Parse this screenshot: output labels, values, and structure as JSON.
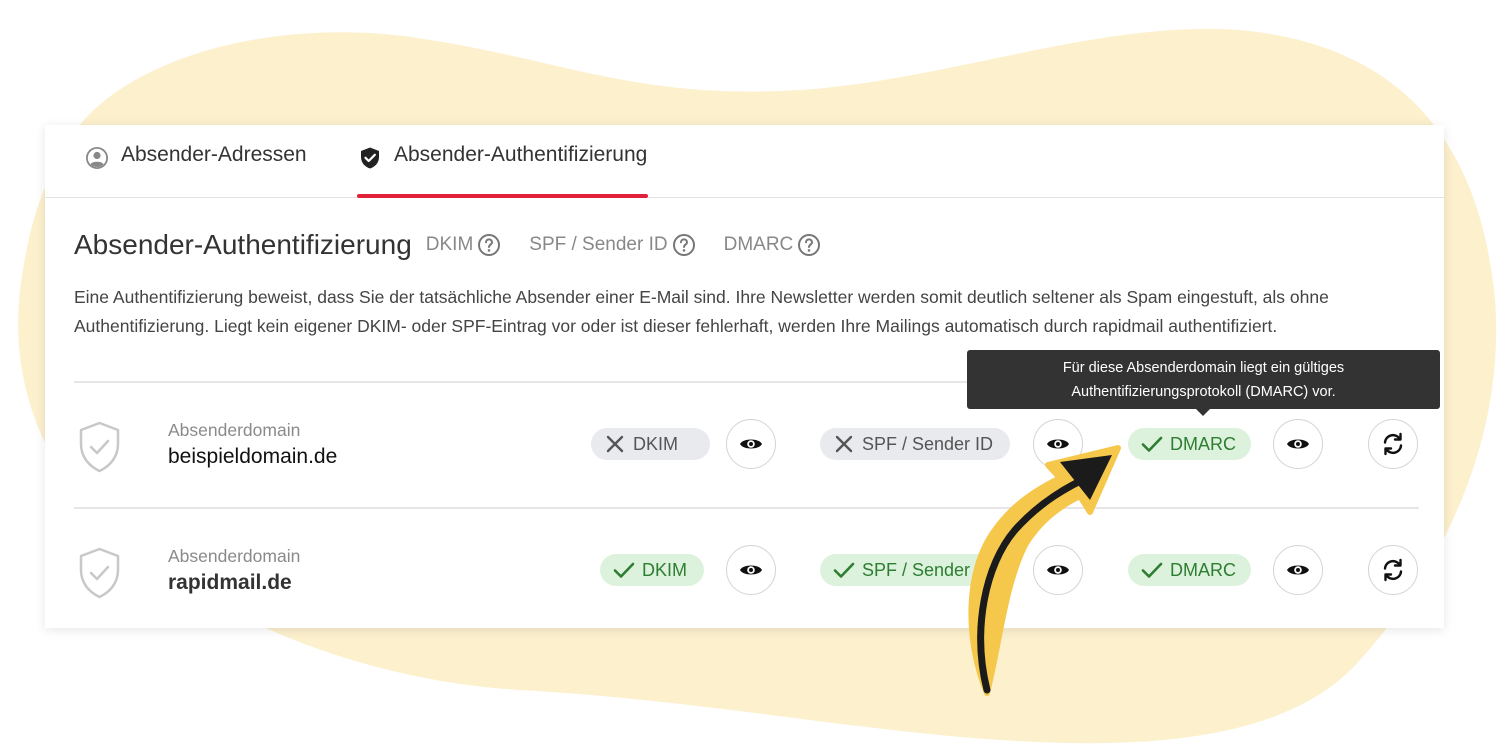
{
  "tabs": [
    {
      "label": "Absender-Adressen",
      "icon": "user-circle-icon",
      "active": false
    },
    {
      "label": "Absender-Authentifizierung",
      "icon": "shield-check-icon",
      "active": true
    }
  ],
  "section": {
    "title": "Absender-Authentifizierung",
    "info_links": [
      "DKIM",
      "SPF / Sender ID",
      "DMARC"
    ],
    "description": "Eine Authentifizierung beweist, dass Sie der tatsächliche Absender einer E-Mail sind. Ihre Newsletter werden somit deutlich seltener als Spam eingestuft, als ohne Authentifizierung. Liegt kein eigener DKIM- oder SPF-Eintrag vor oder ist dieser fehlerhaft, werden Ihre Mailings automatisch durch rapidmail authentifiziert."
  },
  "tooltip": {
    "line1": "Für diese Absenderdomain liegt ein gültiges",
    "line2": "Authentifizierungsprotokoll (DMARC) vor."
  },
  "domains": [
    {
      "label": "Absenderdomain",
      "name": "beispieldomain.de",
      "dkim": {
        "label": "DKIM",
        "status": "fail"
      },
      "spf": {
        "label": "SPF / Sender ID",
        "status": "fail"
      },
      "dmarc": {
        "label": "DMARC",
        "status": "ok"
      }
    },
    {
      "label": "Absenderdomain",
      "name": "rapidmail.de",
      "dkim": {
        "label": "DKIM",
        "status": "ok"
      },
      "spf": {
        "label": "SPF / Sender ID",
        "status": "ok"
      },
      "dmarc": {
        "label": "DMARC",
        "status": "ok"
      }
    }
  ],
  "colors": {
    "accent": "#e3203a",
    "success_bg": "#dcf2dc",
    "success_text": "#2e7d32",
    "fail_bg": "#e8eaee",
    "blob": "#fcf0cd",
    "arrow_fill": "#f5c84c",
    "arrow_stroke": "#1b1b1b"
  }
}
